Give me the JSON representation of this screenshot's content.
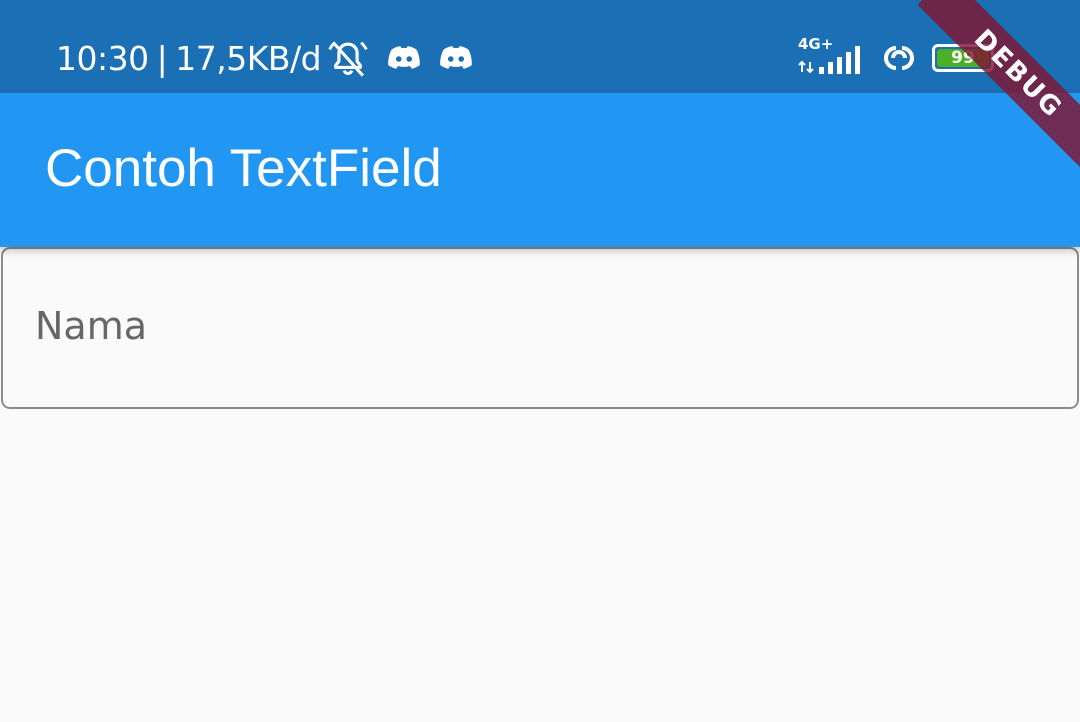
{
  "status_bar": {
    "time": "10:30",
    "separator": "|",
    "network_speed": "17,5KB/d",
    "icons": [
      "bell-off-icon",
      "discord-icon",
      "discord-icon"
    ],
    "network_type": "4G+",
    "signal_icon": "signal-strength-icon",
    "link_icon": "linked-rings-icon",
    "battery_level": "99",
    "colors": {
      "background": "#1a6fb5",
      "battery_fill": "#4caf26"
    }
  },
  "app_bar": {
    "title": "Contoh TextField",
    "color": "#2196f3"
  },
  "form": {
    "name_field": {
      "label": "Nama",
      "value": ""
    }
  },
  "debug_banner": {
    "text": "DEBUG",
    "color": "#801632"
  }
}
